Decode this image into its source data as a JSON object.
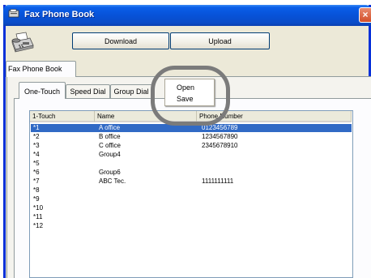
{
  "window": {
    "title": "Fax Phone Book",
    "close_glyph": "×",
    "title_icon": "fax-book-icon"
  },
  "toolbar": {
    "icon": "fax-machine-icon",
    "download_label": "Download",
    "upload_label": "Upload"
  },
  "top_tab": {
    "label": "Fax Phone Book"
  },
  "tabs": [
    {
      "label": "One-Touch",
      "active": true
    },
    {
      "label": "Speed Dial",
      "active": false
    },
    {
      "label": "Group Dial",
      "active": false
    }
  ],
  "table": {
    "columns": [
      "1-Touch",
      "Name",
      "Phone Number"
    ],
    "rows": [
      {
        "touch": "*1",
        "name": "A office",
        "phone": "0123456789",
        "selected": true
      },
      {
        "touch": "*2",
        "name": "B office",
        "phone": "1234567890"
      },
      {
        "touch": "*3",
        "name": "C office",
        "phone": "2345678910"
      },
      {
        "touch": "*4",
        "name": "Group4",
        "phone": ""
      },
      {
        "touch": "*5",
        "name": "",
        "phone": ""
      },
      {
        "touch": "*6",
        "name": "Group6",
        "phone": ""
      },
      {
        "touch": "*7",
        "name": "ABC Tec.",
        "phone": "1111111111"
      },
      {
        "touch": "*8",
        "name": "",
        "phone": ""
      },
      {
        "touch": "*9",
        "name": "",
        "phone": ""
      },
      {
        "touch": "*10",
        "name": "",
        "phone": ""
      },
      {
        "touch": "*11",
        "name": "",
        "phone": ""
      },
      {
        "touch": "*12",
        "name": "",
        "phone": ""
      }
    ]
  },
  "context_menu": {
    "items": [
      "Open",
      "Save"
    ]
  },
  "colors": {
    "title_bar": "#0752d8",
    "selection": "#316ac5",
    "highlight_ring": "#7b7b7b"
  }
}
